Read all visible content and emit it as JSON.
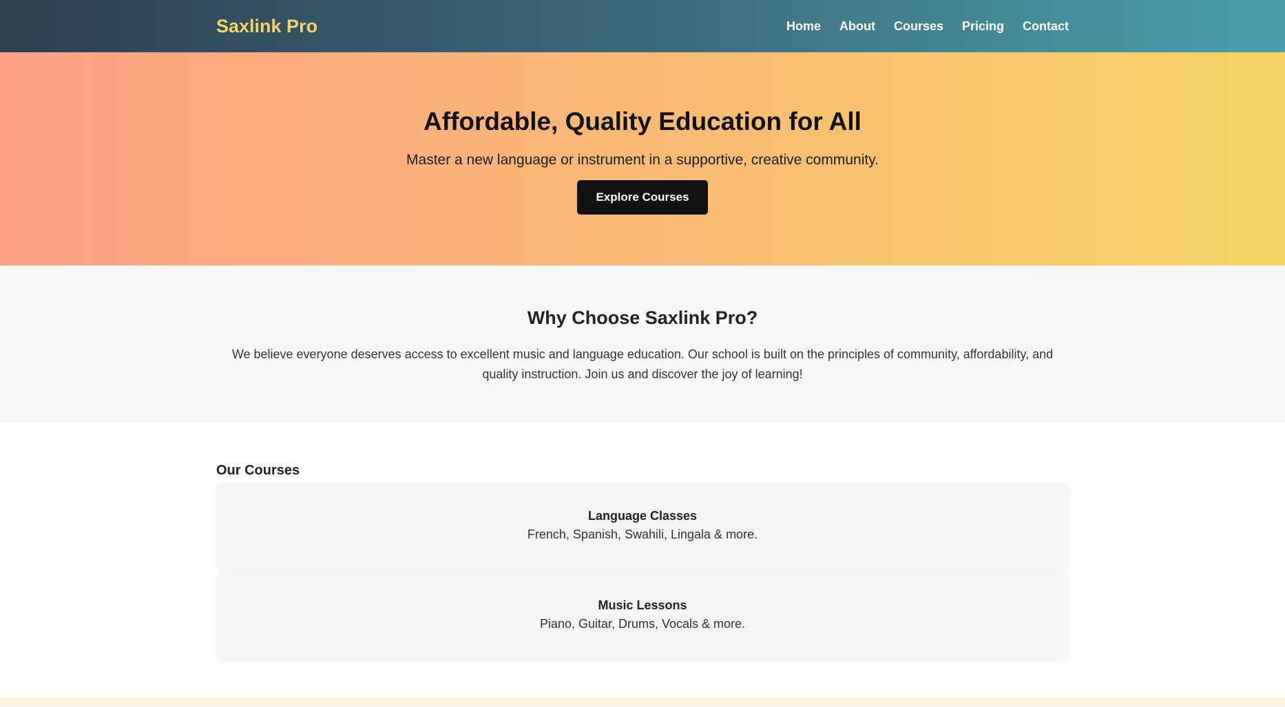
{
  "header": {
    "logo": "Saxlink Pro",
    "nav": [
      "Home",
      "About",
      "Courses",
      "Pricing",
      "Contact"
    ]
  },
  "hero": {
    "title": "Affordable, Quality Education for All",
    "subtitle": "Master a new language or instrument in a supportive, creative community.",
    "cta_label": "Explore Courses"
  },
  "why": {
    "title": "Why Choose Saxlink Pro?",
    "body": "We believe everyone deserves access to excellent music and language education. Our school is built on the principles of community, affordability, and quality instruction. Join us and discover the joy of learning!"
  },
  "courses": {
    "heading": "Our Courses",
    "items": [
      {
        "title": "Language Classes",
        "desc": "French, Spanish, Swahili, Lingala & more."
      },
      {
        "title": "Music Lessons",
        "desc": "Piano, Guitar, Drums, Vocals & more."
      }
    ]
  },
  "colors": {
    "header_start": "#2c3e50",
    "header_end": "#4a9fad",
    "logo": "#f6d365",
    "hero_start": "#fda085",
    "hero_end": "#f6d365",
    "button": "#111111"
  }
}
